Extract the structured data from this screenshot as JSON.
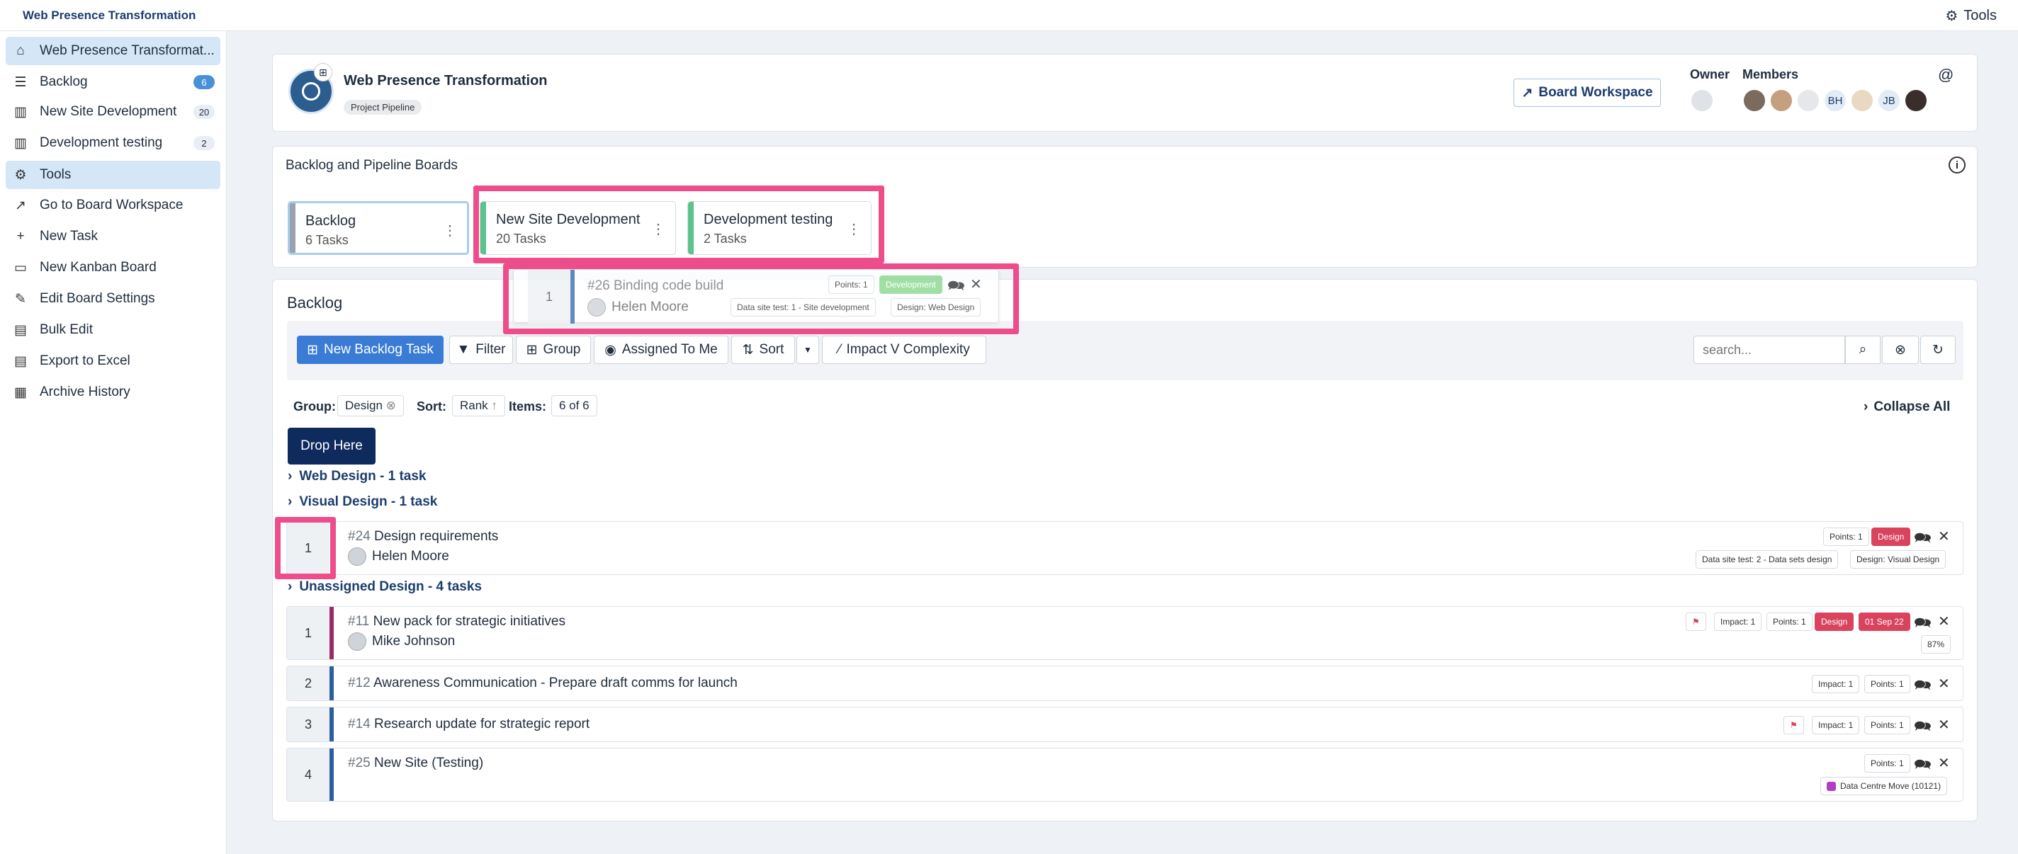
{
  "app": {
    "title": "Web Presence Transformation",
    "tools_label": "Tools"
  },
  "sidebar": {
    "items": [
      {
        "label": "Web Presence Transformat...",
        "icon": "home-icon",
        "active": true
      },
      {
        "label": "Backlog",
        "icon": "list-icon",
        "badge": "6"
      },
      {
        "label": "New Site Development",
        "icon": "kanban-icon",
        "badge": "20"
      },
      {
        "label": "Development testing",
        "icon": "kanban-icon",
        "badge": "2"
      },
      {
        "label": "Tools",
        "icon": "gear-icon",
        "active": true
      },
      {
        "label": "Go to Board Workspace",
        "icon": "external-link-icon"
      },
      {
        "label": "New Task",
        "icon": "plus-icon"
      },
      {
        "label": "New Kanban Board",
        "icon": "board-icon"
      },
      {
        "label": "Edit Board Settings",
        "icon": "edit-icon"
      },
      {
        "label": "Bulk Edit",
        "icon": "excel-icon"
      },
      {
        "label": "Export to Excel",
        "icon": "export-icon"
      },
      {
        "label": "Archive History",
        "icon": "chart-icon"
      }
    ]
  },
  "project": {
    "name": "Web Presence Transformation",
    "tag": "Project Pipeline",
    "workspace_btn": "Board Workspace",
    "owner_label": "Owner",
    "members_label": "Members",
    "member_initials": [
      "BH",
      "JB"
    ]
  },
  "boards": {
    "title": "Backlog and Pipeline Boards",
    "cards": [
      {
        "name": "Backlog",
        "count": "6 Tasks"
      },
      {
        "name": "New Site Development",
        "count": "20 Tasks"
      },
      {
        "name": "Development testing",
        "count": "2 Tasks"
      }
    ]
  },
  "drag_preview": {
    "rank": "1",
    "num": "#26",
    "title": "Binding code build",
    "assignee": "Helen Moore",
    "points": "Points: 1",
    "status": "Development",
    "tag1": "Data site test: 1 - Site development",
    "tag2": "Design: Web Design"
  },
  "backlog": {
    "title": "Backlog",
    "toolbar": {
      "new": "New Backlog Task",
      "filter": "Filter",
      "group": "Group",
      "assigned": "Assigned To Me",
      "sort": "Sort",
      "impact": "Impact V Complexity",
      "search_placeholder": "search..."
    },
    "group_label": "Group:",
    "group_value": "Design",
    "sort_label": "Sort:",
    "sort_value": "Rank",
    "items_label": "Items:",
    "items_value": "6 of 6",
    "collapse": "Collapse All",
    "drop_here": "Drop Here",
    "groups": [
      "Web Design - 1 task",
      "Visual Design - 1 task",
      "Unassigned Design - 4 tasks"
    ],
    "rows": [
      {
        "rank": "1",
        "num": "#24",
        "title": "Design requirements",
        "assignee": "Helen Moore",
        "points": "Points: 1",
        "design": "Design",
        "tag1": "Data site test: 2 - Data sets design",
        "tag2": "Design: Visual Design"
      },
      {
        "rank": "1",
        "num": "#11",
        "title": "New pack for strategic initiatives",
        "assignee": "Mike Johnson",
        "impact": "Impact: 1",
        "points": "Points: 1",
        "design": "Design",
        "date": "01 Sep 22",
        "pct": "87%"
      },
      {
        "rank": "2",
        "num": "#12",
        "title": "Awareness Communication - Prepare draft comms for launch",
        "impact": "Impact: 1",
        "points": "Points: 1"
      },
      {
        "rank": "3",
        "num": "#14",
        "title": "Research update for strategic report",
        "impact": "Impact: 1",
        "points": "Points: 1"
      },
      {
        "rank": "4",
        "num": "#25",
        "title": "New Site (Testing)",
        "points": "Points: 1",
        "link": "Data Centre Move (10121)"
      }
    ]
  },
  "colors": {
    "accent": "#3a7bd5",
    "highlight": "#ee4d8c",
    "navy": "#0f2a5c",
    "danger": "#d9435e",
    "success": "#5cc38a"
  }
}
